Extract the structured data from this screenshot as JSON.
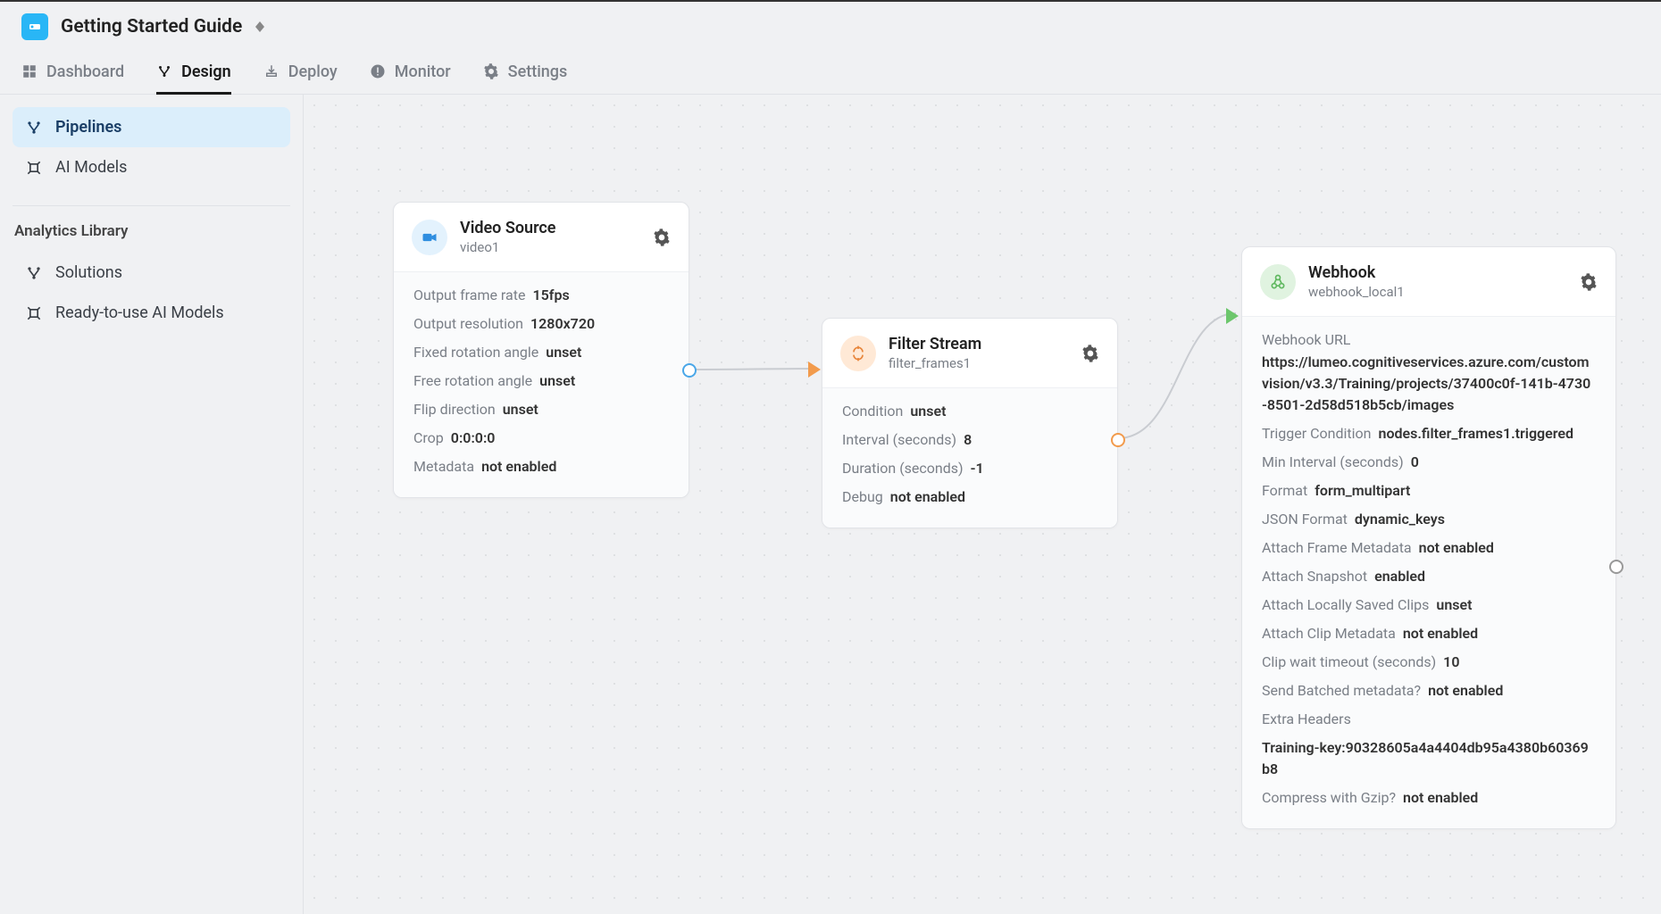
{
  "header": {
    "title": "Getting Started Guide"
  },
  "nav": {
    "dashboard": "Dashboard",
    "design": "Design",
    "deploy": "Deploy",
    "monitor": "Monitor",
    "settings": "Settings"
  },
  "sidebar": {
    "pipelines": "Pipelines",
    "ai_models": "AI Models",
    "heading": "Analytics Library",
    "solutions": "Solutions",
    "ready_models": "Ready-to-use AI Models"
  },
  "nodes": {
    "video": {
      "title": "Video Source",
      "sub": "video1",
      "props": [
        {
          "label": "Output frame rate",
          "value": "15fps"
        },
        {
          "label": "Output resolution",
          "value": "1280x720"
        },
        {
          "label": "Fixed rotation angle",
          "value": "unset"
        },
        {
          "label": "Free rotation angle",
          "value": "unset"
        },
        {
          "label": "Flip direction",
          "value": "unset"
        },
        {
          "label": "Crop",
          "value": "0:0:0:0"
        },
        {
          "label": "Metadata",
          "value": "not enabled"
        }
      ]
    },
    "filter": {
      "title": "Filter Stream",
      "sub": "filter_frames1",
      "props": [
        {
          "label": "Condition",
          "value": "unset"
        },
        {
          "label": "Interval (seconds)",
          "value": "8"
        },
        {
          "label": "Duration (seconds)",
          "value": "-1"
        },
        {
          "label": "Debug",
          "value": "not enabled"
        }
      ]
    },
    "webhook": {
      "title": "Webhook",
      "sub": "webhook_local1",
      "url_label": "Webhook URL",
      "url_value": "https://lumeo.cognitiveservices.azure.com/customvision/v3.3/Training/projects/37400c0f-141b-4730-8501-2d58d518b5cb/images",
      "props": [
        {
          "label": "Trigger Condition",
          "value": "nodes.filter_frames1.triggered"
        },
        {
          "label": "Min Interval (seconds)",
          "value": "0"
        },
        {
          "label": "Format",
          "value": "form_multipart"
        },
        {
          "label": "JSON Format",
          "value": "dynamic_keys"
        },
        {
          "label": "Attach Frame Metadata",
          "value": "not enabled"
        },
        {
          "label": "Attach Snapshot",
          "value": "enabled"
        },
        {
          "label": "Attach Locally Saved Clips",
          "value": "unset"
        },
        {
          "label": "Attach Clip Metadata",
          "value": "not enabled"
        },
        {
          "label": "Clip wait timeout (seconds)",
          "value": "10"
        },
        {
          "label": "Send Batched metadata?",
          "value": "not enabled"
        },
        {
          "label": "Extra Headers",
          "value": "Training-key:90328605a4a4404db95a4380b60369b8"
        },
        {
          "label": "Compress with Gzip?",
          "value": "not enabled"
        }
      ]
    }
  }
}
